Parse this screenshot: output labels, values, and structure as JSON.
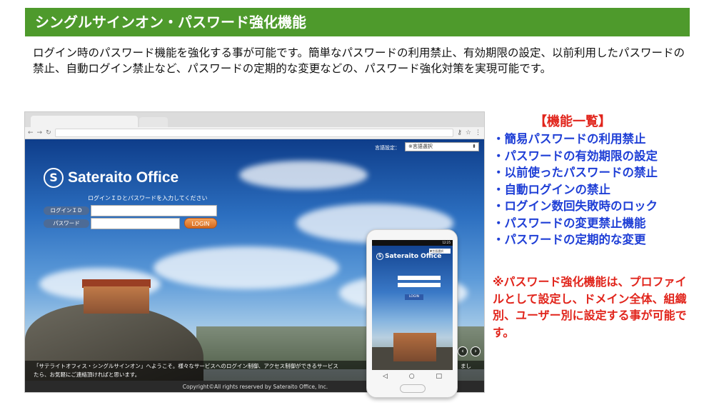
{
  "title": "シングルサインオン・パスワード強化機能",
  "intro": "ログイン時のパスワード機能を強化する事が可能です。簡単なパスワードの利用禁止、有効期限の設定、以前利用したパスワードの禁止、自動ログイン禁止など、パスワードの定期的な変更などの、パスワード強化対策を実現可能です。",
  "browser": {
    "language_label": "言語設定：",
    "language_select": "※言語選択",
    "logo_text": "Sateraito Office",
    "login_hint": "ログインＩＤとパスワードを入力してください",
    "login_id_label": "ログインＩＤ",
    "password_label": "パスワード",
    "login_button": "LOGIN",
    "welcome_line1": "「サテライトオフィス・シングルサインオン」へようこそ。様々なサービスへのログイン制御、アクセス制御ができるサービス",
    "welcome_line1_end": "まし",
    "welcome_line2": "たら、お気軽にご連絡頂ければと思います。",
    "footer": "Copyright©All rights reserved by Sateraito Office, Inc."
  },
  "phone": {
    "status_time": "12:25",
    "logo_text": "Sateraito Office",
    "language_select": "▼言語選択",
    "login_button": "LOGIN"
  },
  "features": {
    "heading": "【機能一覧】",
    "items": [
      "・簡易パスワードの利用禁止",
      "・パスワードの有効期限の設定",
      "・以前使ったパスワードの禁止",
      "・自動ログインの禁止",
      "・ログイン数回失敗時のロック",
      "・パスワードの変更禁止機能",
      "・パスワードの定期的な変更"
    ]
  },
  "note": "※パスワード強化機能は、プロファイルとして設定し、ドメイン全体、組織別、ユーザー別に設定する事が可能です。",
  "colors": {
    "title_bg": "#4e9a2c",
    "feature_text": "#1f3fd6",
    "accent_red": "#e1241b"
  }
}
